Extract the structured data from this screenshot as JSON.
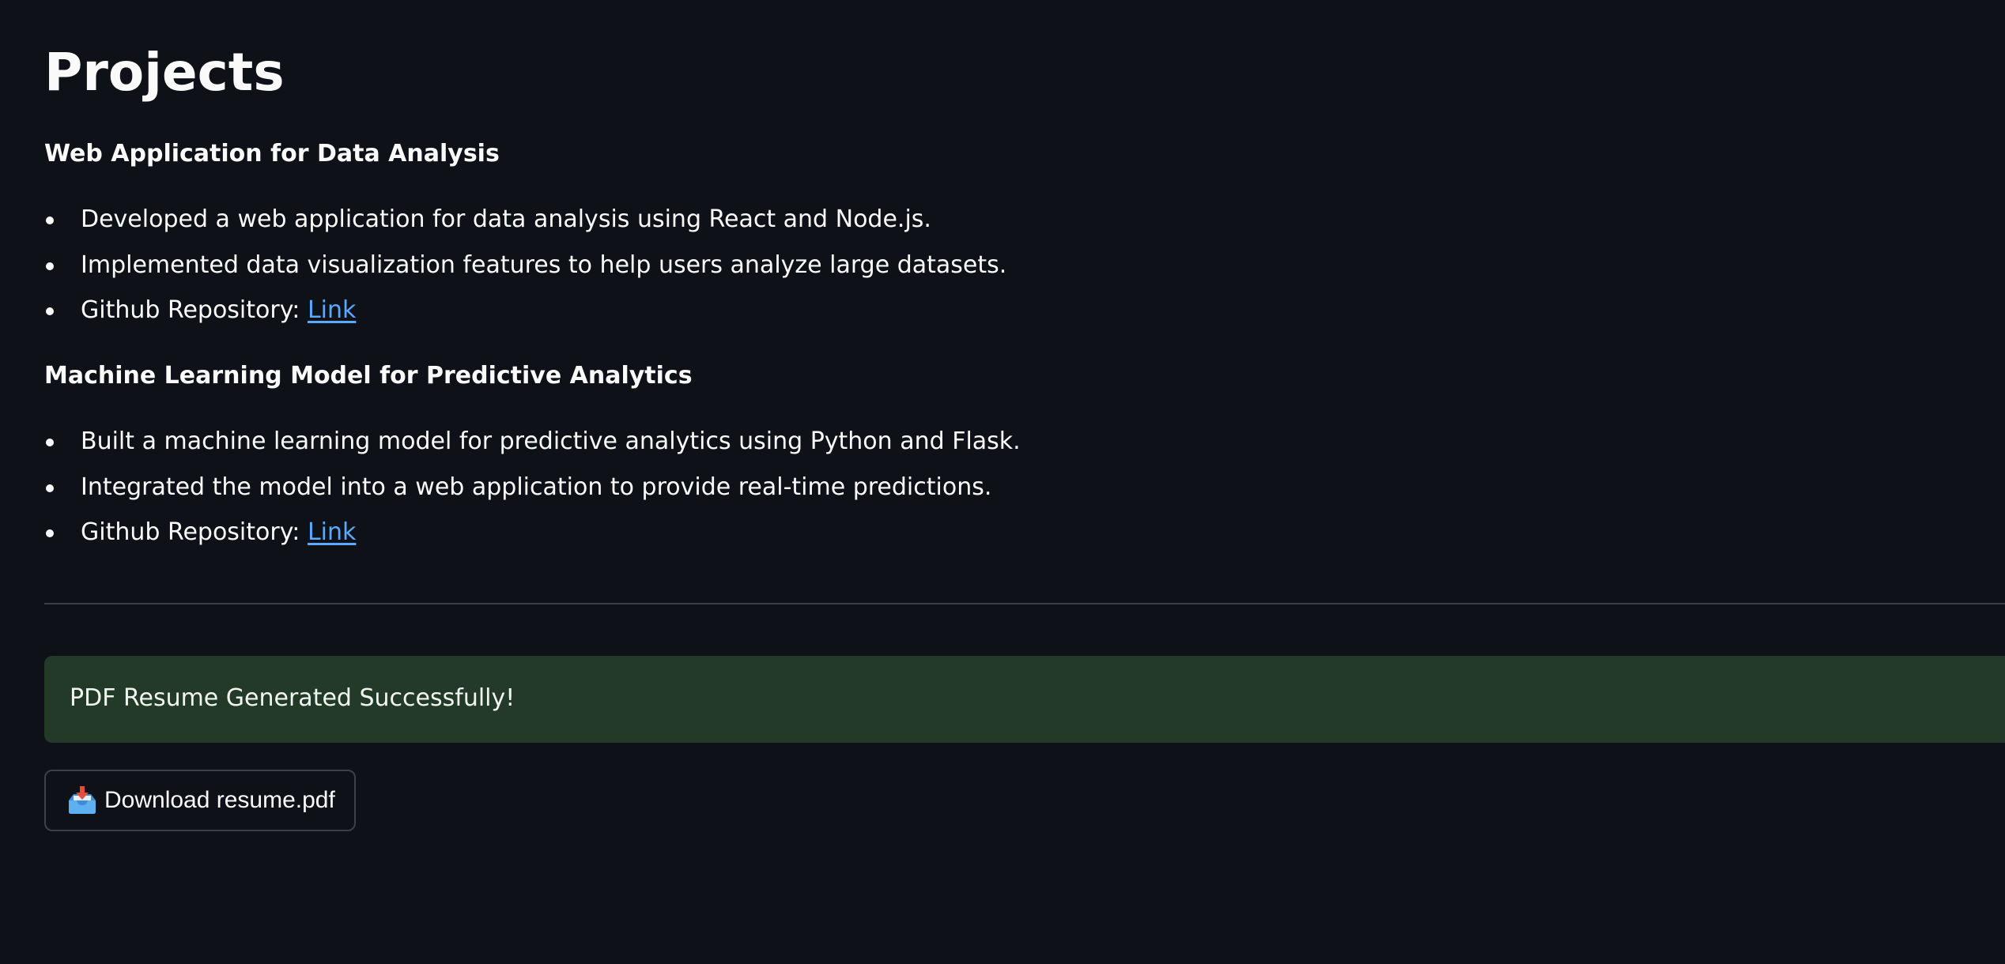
{
  "page": {
    "title": "Projects"
  },
  "projects": [
    {
      "title": "Web Application for Data Analysis",
      "bullets": [
        "Developed a web application for data analysis using React and Node.js.",
        "Implemented data visualization features to help users analyze large datasets."
      ],
      "repo_label": "Github Repository: ",
      "repo_link_text": "Link"
    },
    {
      "title": "Machine Learning Model for Predictive Analytics",
      "bullets": [
        "Built a machine learning model for predictive analytics using Python and Flask.",
        "Integrated the model into a web application to provide real-time predictions."
      ],
      "repo_label": "Github Repository: ",
      "repo_link_text": "Link"
    }
  ],
  "alert": {
    "message": "PDF Resume Generated Successfully!",
    "color": "#233a28"
  },
  "download": {
    "label": "Download resume.pdf",
    "icon": "inbox-tray-icon"
  },
  "colors": {
    "background": "#0e1117",
    "text": "#fafafa",
    "link": "#5aa9ff"
  }
}
